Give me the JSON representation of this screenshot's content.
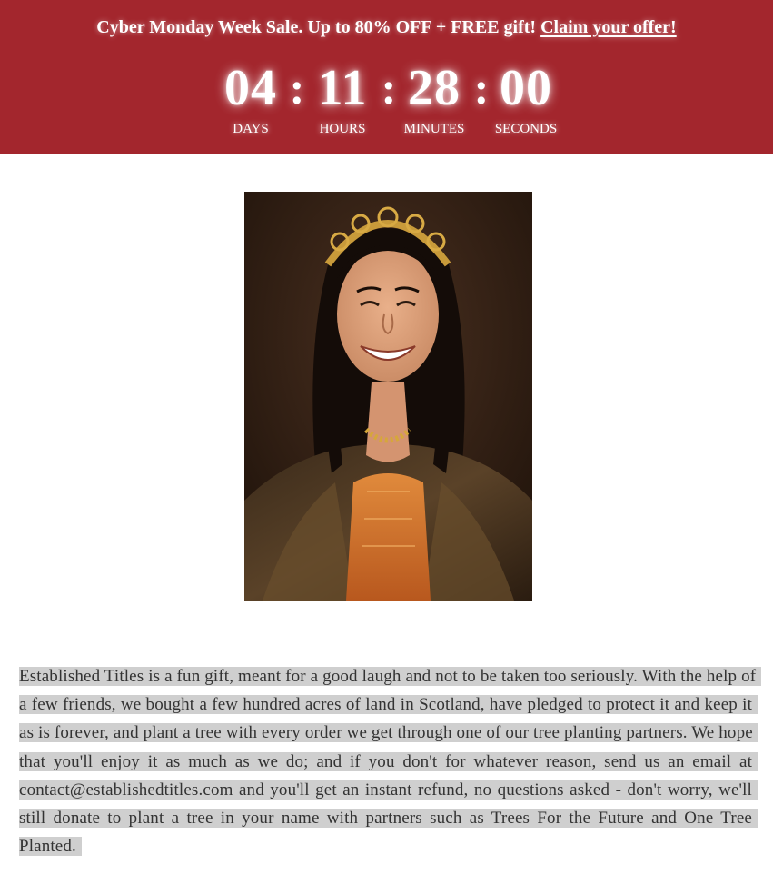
{
  "banner": {
    "promo_text": "Cyber Monday Week Sale. Up to 80% OFF + FREE gift! ",
    "claim_link": "Claim your offer!",
    "background_color": "#a3262d"
  },
  "countdown": {
    "days": "04",
    "days_label": "DAYS",
    "hours": "11",
    "hours_label": "HOURS",
    "minutes": "28",
    "minutes_label": "MINUTES",
    "seconds": "00",
    "seconds_label": "SECONDS",
    "separator": ":"
  },
  "portrait": {
    "icon": "portrait-image"
  },
  "description": {
    "text": "Established Titles is a fun gift, meant for a good laugh and not to be taken too seriously. With the help of a few friends, we bought a few hundred acres of land in Scotland, have pledged to protect it and keep it as is forever, and plant a tree with every order we get through one of our tree planting partners. We hope that you'll enjoy it as much as we do; and if you don't for whatever reason, send us an email at contact@establishedtitles.com and you'll get an instant refund, no questions asked - don't worry, we'll still donate to plant a tree in your name with partners such as Trees For the Future and One Tree Planted."
  }
}
